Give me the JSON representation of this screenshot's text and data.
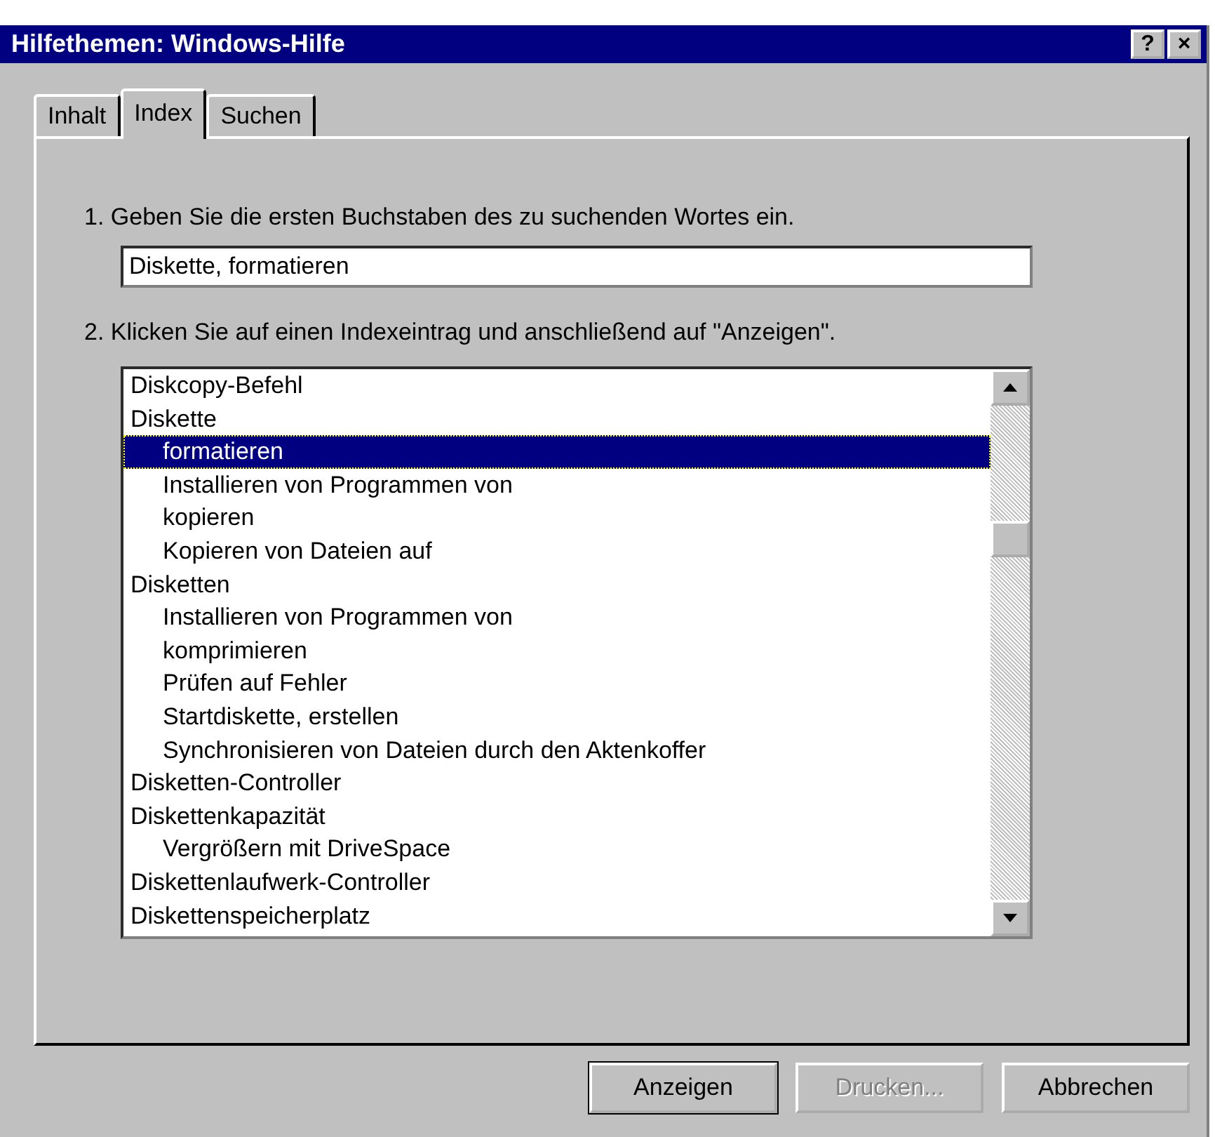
{
  "window": {
    "title": "Hilfethemen: Windows-Hilfe",
    "title_buttons": [
      "?",
      "×"
    ]
  },
  "tabs": [
    {
      "label": "Inhalt",
      "selected": false
    },
    {
      "label": "Index",
      "selected": true
    },
    {
      "label": "Suchen",
      "selected": false
    }
  ],
  "step_1": {
    "label": "1. Geben Sie die ersten Buchstaben des zu suchenden Wortes ein.",
    "value": "Diskette, formatieren"
  },
  "step_2": {
    "label": "2. Klicken Sie auf einen Indexeintrag und anschließend auf \"Anzeigen\"."
  },
  "index_list": [
    {
      "label": "Diskcopy-Befehl",
      "selected": false
    },
    {
      "label": "Diskette",
      "selected": false,
      "children": [
        {
          "label": "formatieren",
          "selected": true
        },
        {
          "label": "Installieren von Programmen von",
          "selected": false
        },
        {
          "label": "kopieren",
          "selected": false
        },
        {
          "label": "Kopieren von Dateien auf",
          "selected": false
        }
      ]
    },
    {
      "label": "Disketten",
      "selected": false,
      "children": [
        {
          "label": "Installieren von Programmen von",
          "selected": false
        },
        {
          "label": "komprimieren",
          "selected": false
        },
        {
          "label": "Prüfen auf Fehler",
          "selected": false
        },
        {
          "label": "Startdiskette, erstellen",
          "selected": false
        },
        {
          "label": "Synchronisieren von Dateien durch den Aktenkoffer",
          "selected": false
        }
      ]
    },
    {
      "label": "Disketten-Controller",
      "selected": false
    },
    {
      "label": "Diskettenkapazität",
      "selected": false,
      "children": [
        {
          "label": "Vergrößern mit DriveSpace",
          "selected": false
        }
      ]
    },
    {
      "label": "Diskettenlaufwerk-Controller",
      "selected": false
    },
    {
      "label": "Diskettenspeicherplatz",
      "selected": false
    }
  ],
  "buttons": [
    {
      "label": "Anzeigen",
      "disabled": false,
      "default": true
    },
    {
      "label": "Drucken...",
      "disabled": true,
      "default": false
    },
    {
      "label": "Abbrechen",
      "disabled": false,
      "default": false
    }
  ]
}
